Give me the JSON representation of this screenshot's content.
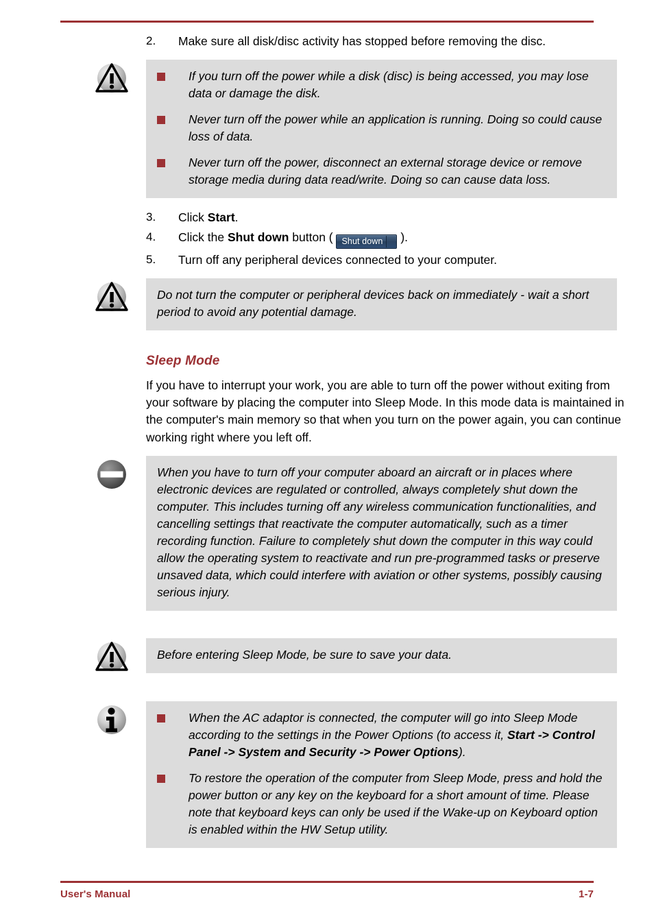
{
  "page": {
    "footer_left": "User's Manual",
    "footer_right": "1-7",
    "accent_color": "#9c3134",
    "box_background": "#dcdcdc"
  },
  "steps": {
    "step2": {
      "num": "2.",
      "text": "Make sure all disk/disc activity has stopped before removing the disc."
    },
    "step3": {
      "num": "3.",
      "prefix": "Click ",
      "bold": "Start",
      "suffix": "."
    },
    "step4": {
      "num": "4.",
      "prefix": "Click the ",
      "bold": "Shut down",
      "mid": " button ( ",
      "button_label": "Shut down",
      "suffix": " )."
    },
    "step5": {
      "num": "5.",
      "text": "Turn off any peripheral devices connected to your computer."
    }
  },
  "caution_disk": {
    "icon": "warning-triangle-icon",
    "bullets": [
      "If you turn off the power while a disk (disc) is being accessed, you may lose data or damage the disk.",
      "Never turn off the power while an application is running. Doing so could cause loss of data.",
      "Never turn off the power, disconnect an external storage device or remove storage media during data read/write. Doing so can cause data loss."
    ]
  },
  "caution_restart": {
    "icon": "warning-triangle-icon",
    "text": "Do not turn the computer or peripheral devices back on immediately - wait a short period to avoid any potential damage."
  },
  "sleep_mode": {
    "heading": "Sleep Mode",
    "paragraph": "If you have to interrupt your work, you are able to turn off the power without exiting from your software by placing the computer into Sleep Mode. In this mode data is maintained in the computer's main memory so that when you turn on the power again, you can continue working right where you left off."
  },
  "caution_aircraft": {
    "icon": "prohibition-icon",
    "text": "When you have to turn off your computer aboard an aircraft or in places where electronic devices are regulated or controlled, always completely shut down the computer. This includes turning off any wireless communication functionalities, and cancelling settings that reactivate the computer automatically, such as a timer recording function. Failure to completely shut down the computer in this way could allow the operating system to reactivate and run pre-programmed tasks or preserve unsaved data, which could interfere with aviation or other systems, possibly causing serious injury."
  },
  "caution_save": {
    "icon": "warning-triangle-icon",
    "text": "Before entering Sleep Mode, be sure to save your data."
  },
  "info_sleep": {
    "icon": "info-icon",
    "bullet1": {
      "lead": "When the AC adaptor is connected, the computer will go into Sleep Mode according to the settings in the Power Options (to access it, ",
      "bold": "Start -> Control Panel -> System and Security -> Power Options",
      "tail": ")."
    },
    "bullet2": "To restore the operation of the computer from Sleep Mode, press and hold the power button or any key on the keyboard for a short amount of time. Please note that keyboard keys can only be used if the Wake-up on Keyboard option is enabled within the HW Setup utility."
  }
}
